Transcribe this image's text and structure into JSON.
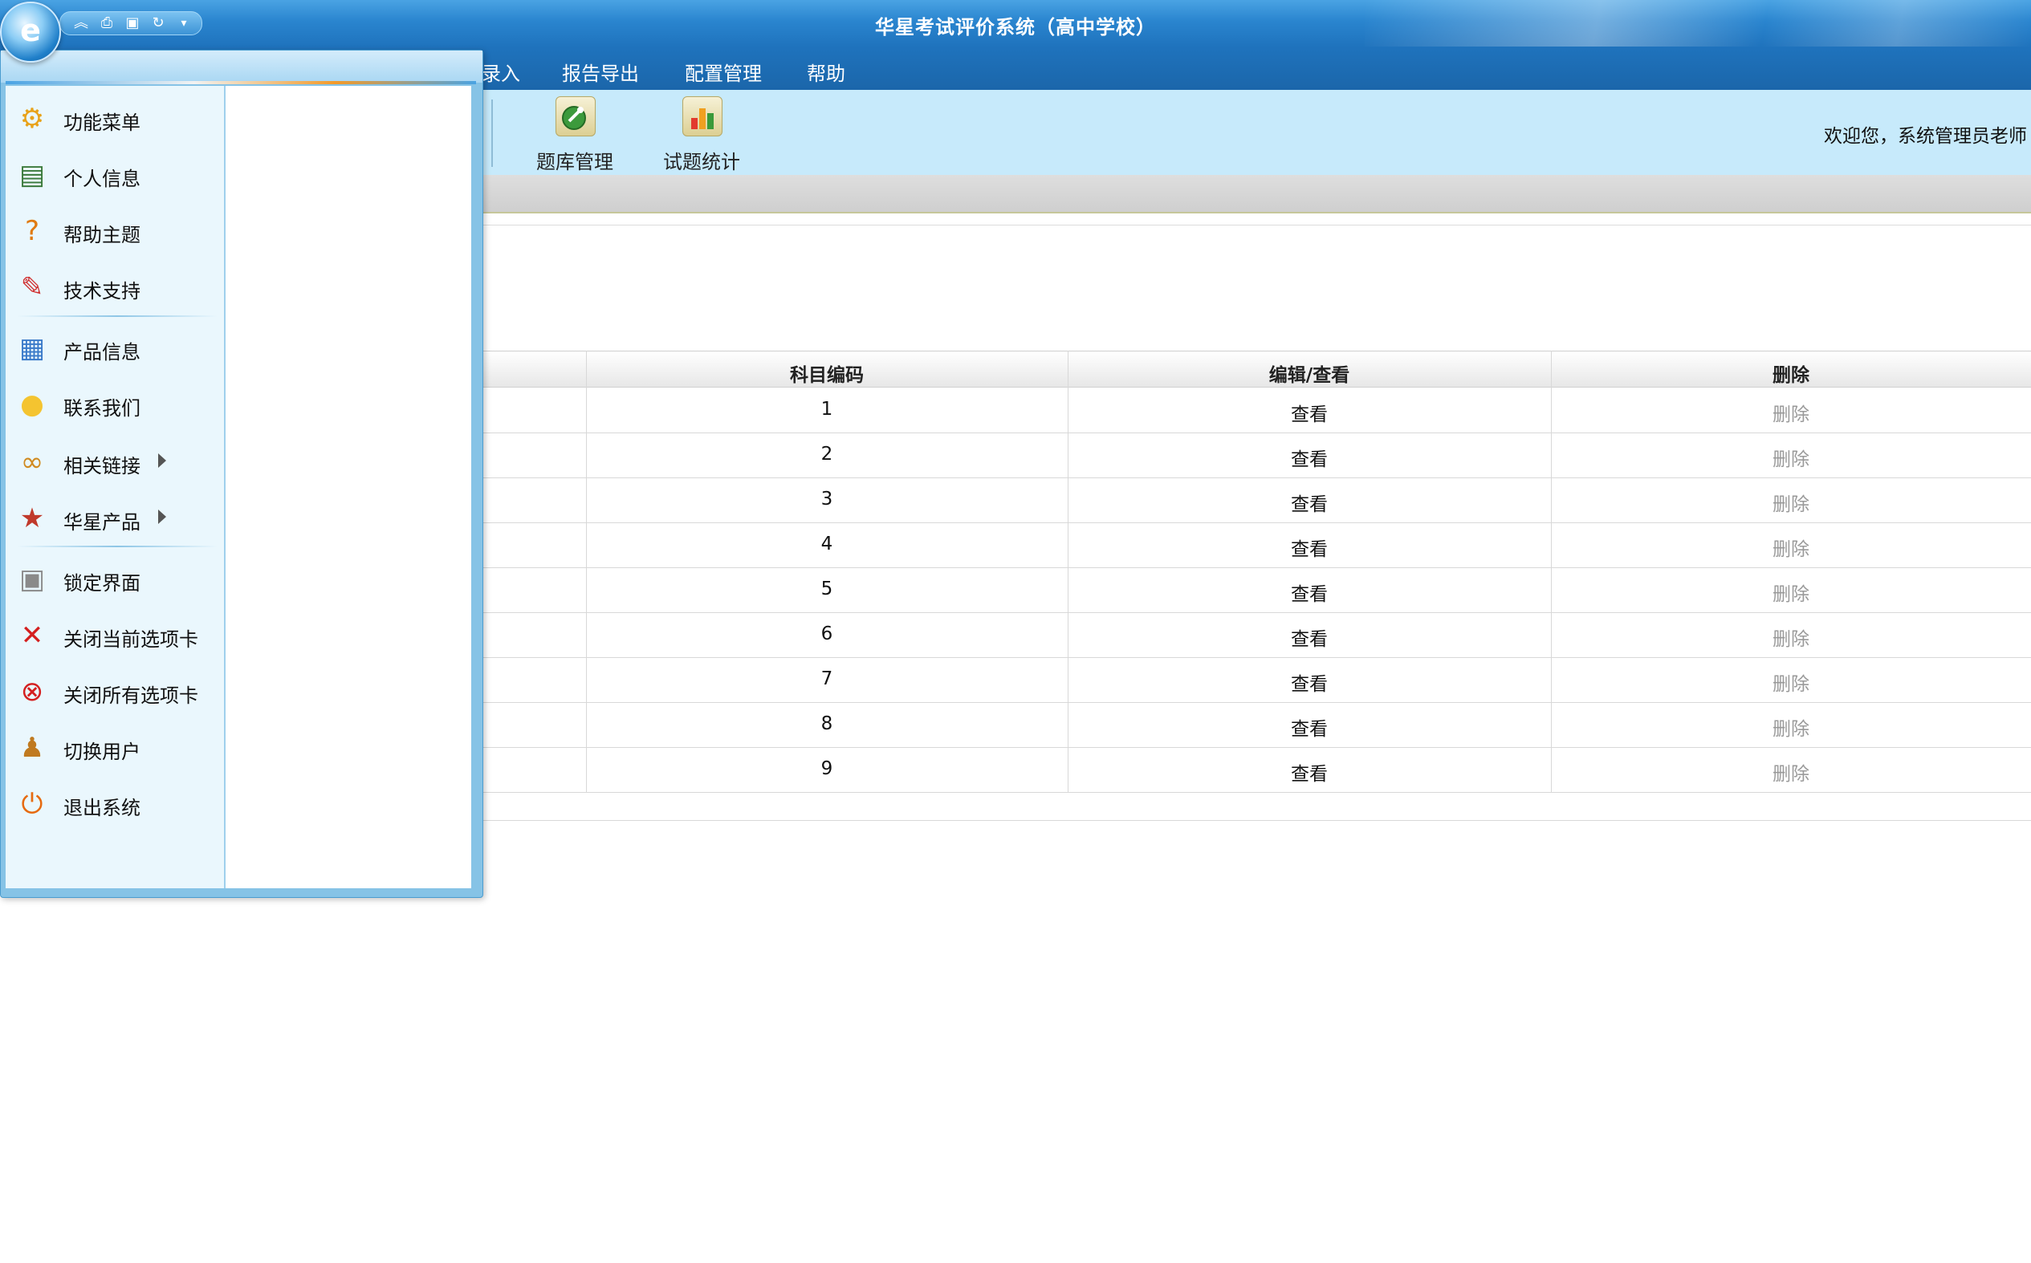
{
  "window": {
    "title": "华星考试评价系统（高中学校）"
  },
  "menubar": {
    "items": [
      "录入",
      "报告导出",
      "配置管理",
      "帮助"
    ]
  },
  "toolbar": {
    "buttons": [
      {
        "label": "题库管理",
        "icon": "question-bank-icon"
      },
      {
        "label": "试题统计",
        "icon": "bar-chart-icon"
      }
    ],
    "welcome": "欢迎您，系统管理员老师"
  },
  "table": {
    "headers": [
      "科目编码",
      "编辑/查看",
      "删除"
    ],
    "rows": [
      {
        "code": "1",
        "view": "查看",
        "delete": "删除"
      },
      {
        "code": "2",
        "view": "查看",
        "delete": "删除"
      },
      {
        "code": "3",
        "view": "查看",
        "delete": "删除"
      },
      {
        "code": "4",
        "view": "查看",
        "delete": "删除"
      },
      {
        "code": "5",
        "view": "查看",
        "delete": "删除"
      },
      {
        "code": "6",
        "view": "查看",
        "delete": "删除"
      },
      {
        "code": "7",
        "view": "查看",
        "delete": "删除"
      },
      {
        "code": "8",
        "view": "查看",
        "delete": "删除"
      },
      {
        "code": "9",
        "view": "查看",
        "delete": "删除"
      }
    ]
  },
  "startmenu": {
    "items": [
      {
        "label": "功能菜单",
        "icon": "gear-icon"
      },
      {
        "label": "个人信息",
        "icon": "id-card-icon"
      },
      {
        "label": "帮助主题",
        "icon": "help-icon"
      },
      {
        "label": "技术支持",
        "icon": "toolbox-icon"
      },
      {
        "label": "产品信息",
        "icon": "document-icon"
      },
      {
        "label": "联系我们",
        "icon": "lightbulb-icon"
      },
      {
        "label": "相关链接",
        "icon": "link-icon",
        "submenu": true
      },
      {
        "label": "华星产品",
        "icon": "medal-icon",
        "submenu": true
      },
      {
        "label": "锁定界面",
        "icon": "lock-icon"
      },
      {
        "label": "关闭当前选项卡",
        "icon": "close-tab-icon"
      },
      {
        "label": "关闭所有选项卡",
        "icon": "close-all-icon"
      },
      {
        "label": "切换用户",
        "icon": "switch-user-icon"
      },
      {
        "label": "退出系统",
        "icon": "power-icon"
      }
    ]
  },
  "colors": {
    "titlebar": "#1f73bd",
    "toolbar_bg": "#c7eafb",
    "delete_text": "#9a9a9a"
  }
}
